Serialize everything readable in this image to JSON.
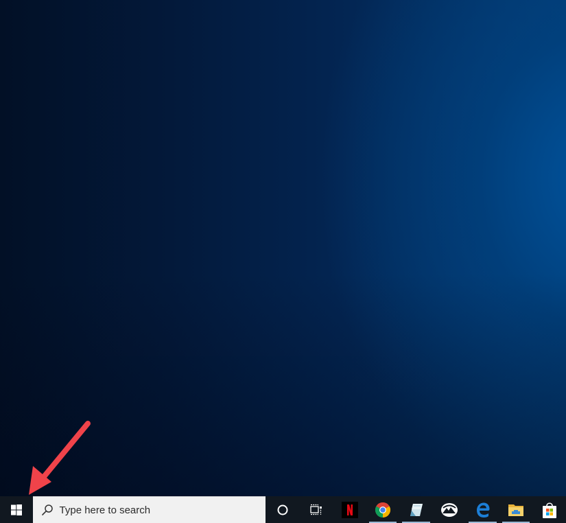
{
  "desktop": {
    "wallpaper": "dark-blue-gradient",
    "annotation": {
      "type": "arrow",
      "color": "#f0434a",
      "points_to": "start-button"
    }
  },
  "taskbar": {
    "start_button": {
      "icon": "windows-logo-icon"
    },
    "search": {
      "placeholder": "Type here to search",
      "icon": "search-icon"
    },
    "buttons": [
      {
        "name": "cortana",
        "icon": "cortana-circle-icon",
        "active": false
      },
      {
        "name": "task-view",
        "icon": "task-view-icon",
        "active": false
      },
      {
        "name": "netflix",
        "icon": "netflix-icon",
        "label": "N",
        "color": "#e50914",
        "active": false
      },
      {
        "name": "chrome",
        "icon": "chrome-icon",
        "active": true
      },
      {
        "name": "notepad",
        "icon": "notepad-icon",
        "active": true
      },
      {
        "name": "photos",
        "icon": "photos-mountain-icon",
        "active": false
      },
      {
        "name": "edge",
        "icon": "edge-icon",
        "label": "e",
        "color": "#1c7ed6",
        "active": true
      },
      {
        "name": "file-explorer",
        "icon": "folder-icon",
        "active": true
      },
      {
        "name": "microsoft-store",
        "icon": "store-bag-icon",
        "active": false
      }
    ]
  }
}
